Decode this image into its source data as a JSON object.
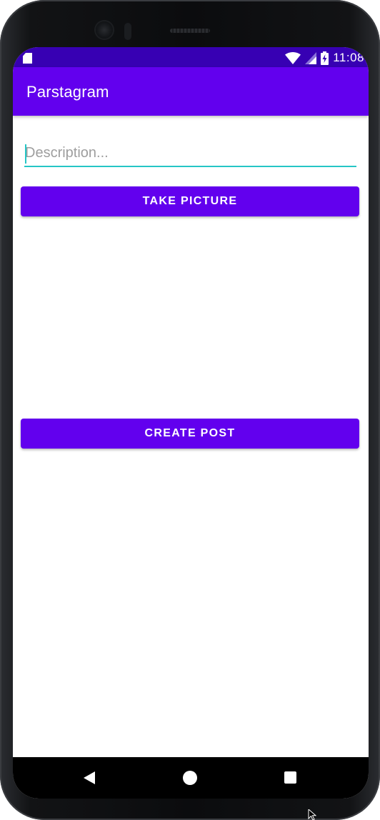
{
  "status_bar": {
    "time": "11:08",
    "icons": [
      "sd-card-icon",
      "wifi-icon",
      "signal-icon",
      "battery-charging-icon"
    ]
  },
  "app_bar": {
    "title": "Parstagram"
  },
  "form": {
    "description_placeholder": "Description...",
    "description_value": "",
    "take_picture_label": "TAKE PICTURE",
    "create_post_label": "CREATE POST"
  },
  "nav_bar": {
    "icons": [
      "back-icon",
      "home-icon",
      "recents-icon"
    ]
  },
  "colors": {
    "status_bar": "#3700b3",
    "primary": "#6200ee",
    "accent": "#26c6c6",
    "background": "#ffffff"
  }
}
